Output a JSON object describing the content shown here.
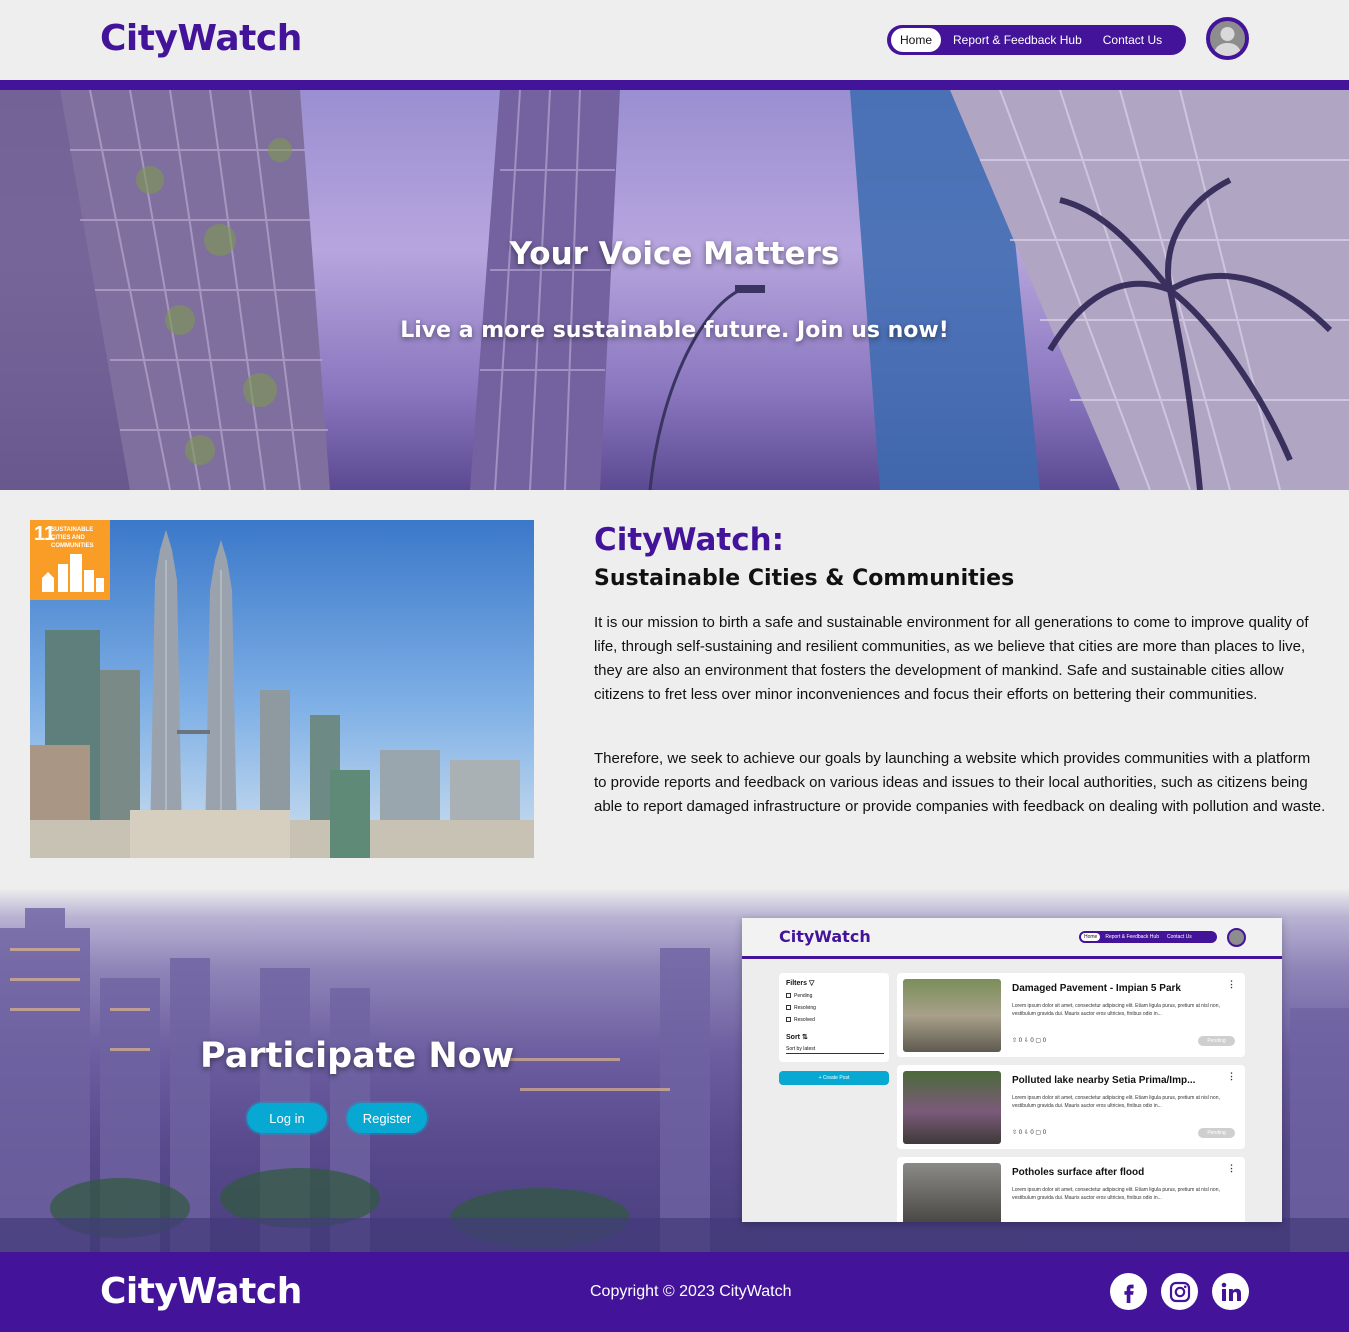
{
  "header": {
    "brand": "CityWatch",
    "nav": [
      "Home",
      "Report & Feedback Hub",
      "Contact Us"
    ],
    "active_nav": "Home"
  },
  "hero": {
    "title": "Your Voice Matters",
    "subtitle": "Live a more sustainable future. Join us now!"
  },
  "about": {
    "sdg_number": "11",
    "sdg_label": "SUSTAINABLE CITIES AND COMMUNITIES",
    "title": "CityWatch:",
    "subtitle": "Sustainable Cities & Communities",
    "paragraphs": [
      "It is our mission to birth a safe and sustainable environment for all generations to come to improve quality of life, through self-sustaining and resilient communities, as we believe that cities are more than places to live, they are also an environment that fosters the development of mankind. Safe and sustainable cities allow citizens to fret less over minor inconveniences and focus their efforts on bettering their communities.",
      "Therefore, we seek to achieve our goals by launching a website which provides communities with a platform to provide reports and feedback on various ideas and issues to their local authorities, such as citizens being able to report damaged infrastructure or provide companies with feedback on dealing with pollution and waste."
    ]
  },
  "participate": {
    "title": "Participate Now",
    "login_label": "Log in",
    "register_label": "Register"
  },
  "preview": {
    "brand": "CityWatch",
    "nav": [
      "Home",
      "Report & Feedback Hub",
      "Contact Us"
    ],
    "filters_label": "Filters",
    "filter_options": [
      "Pending",
      "Resolving",
      "Resolved"
    ],
    "sort_label": "Sort",
    "sort_value": "Sort by latest",
    "create_label": "+ Create Post",
    "posts": [
      {
        "title": "Damaged Pavement - Impian 5 Park",
        "body": "Lorem ipsum dolor sit amet, consectetur adipiscing elit. Etiam ligula purus, pretium at nisl non, vestibulum gravida dui. Mauris auctor eros ultricies, finibus odio in...",
        "stats": "⇧ 0 ⇩ 0 ▢ 0",
        "status": "Pending"
      },
      {
        "title": "Polluted lake nearby Setia Prima/Imp...",
        "body": "Lorem ipsum dolor sit amet, consectetur adipiscing elit. Etiam ligula purus, pretium at nisl non, vestibulum gravida dui. Mauris auctor eros ultricies, finibus odio in...",
        "stats": "⇧ 0 ⇩ 0 ▢ 0",
        "status": "Pending"
      },
      {
        "title": "Potholes surface after flood",
        "body": "Lorem ipsum dolor sit amet, consectetur adipiscing elit. Etiam ligula purus, pretium at nisl non, vestibulum gravida dui. Mauris auctor eros ultricies, finibus odio in..."
      }
    ]
  },
  "footer": {
    "brand": "CityWatch",
    "copyright": "Copyright © 2023 CityWatch",
    "social": [
      "facebook-icon",
      "instagram-icon",
      "linkedin-icon"
    ]
  },
  "colors": {
    "brand": "#43149a",
    "accent": "#07a9d3",
    "background": "#eeeeee",
    "sdg_orange": "#f99d26"
  }
}
